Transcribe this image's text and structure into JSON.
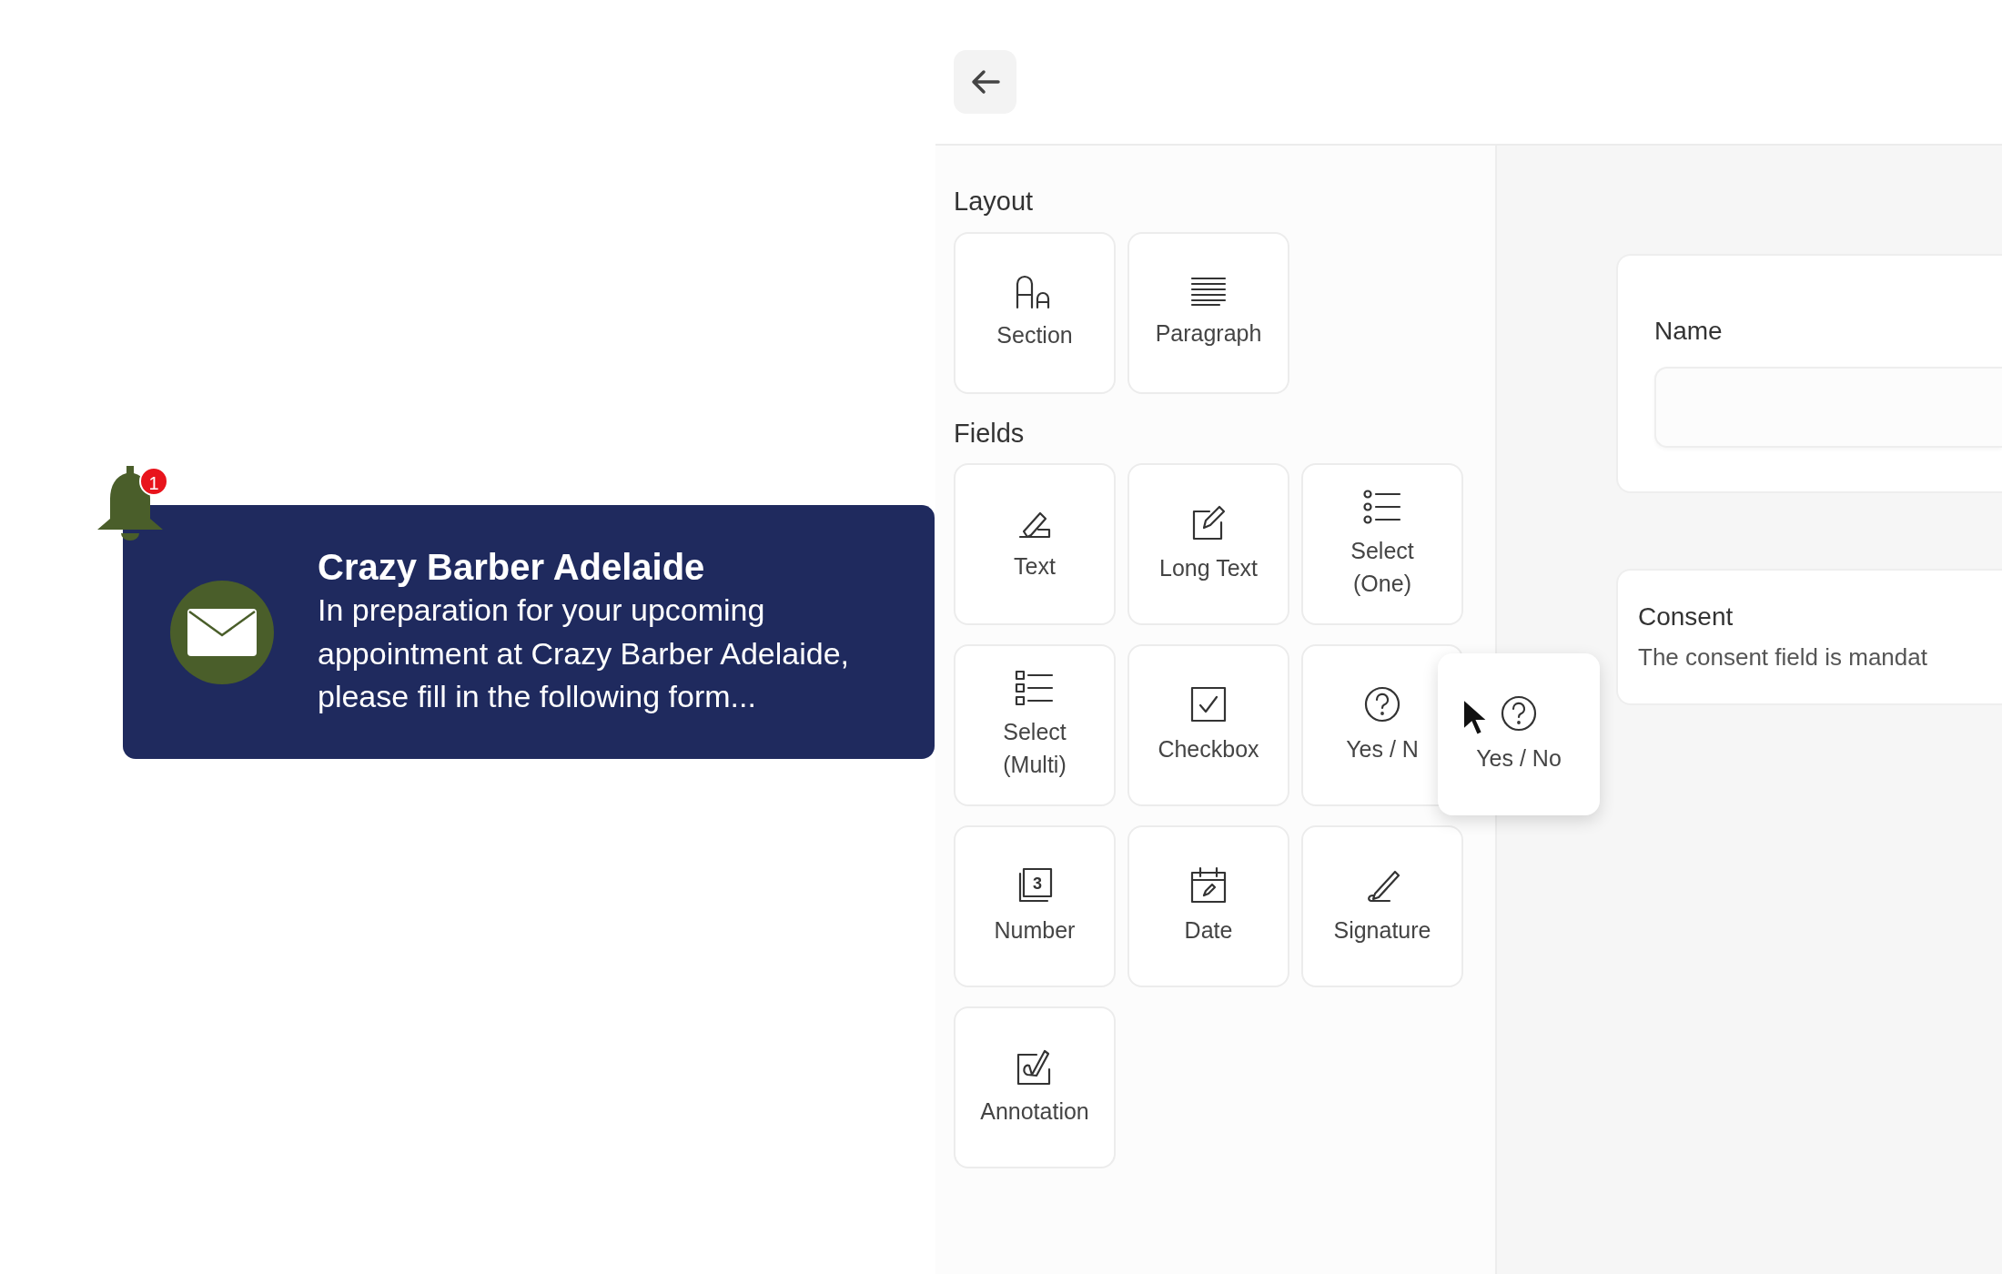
{
  "notification": {
    "badge": "1",
    "title": "Crazy Barber Adelaide",
    "message": "In preparation for your upcoming appointment at Crazy Barber Adelaide, please fill in the following form..."
  },
  "builder": {
    "palette": [
      {
        "heading": "Layout",
        "items": [
          {
            "kind": "section",
            "label": "Section"
          },
          {
            "kind": "paragraph",
            "label": "Paragraph"
          }
        ]
      },
      {
        "heading": "Fields",
        "items": [
          {
            "kind": "text",
            "label": "Text"
          },
          {
            "kind": "longtext",
            "label": "Long Text"
          },
          {
            "kind": "select",
            "label": "Select (One)"
          },
          {
            "kind": "multiselect",
            "label": "Select (Multi)"
          },
          {
            "kind": "checkbox",
            "label": "Checkbox"
          },
          {
            "kind": "yesno",
            "label": "Yes / N"
          },
          {
            "kind": "number",
            "label": "Number",
            "icon_text": "3"
          },
          {
            "kind": "date",
            "label": "Date"
          },
          {
            "kind": "signature",
            "label": "Signature"
          },
          {
            "kind": "annotation",
            "label": "Annotation"
          }
        ]
      }
    ],
    "drag_ghost": {
      "kind": "yesno",
      "label": "Yes / No"
    },
    "form": [
      {
        "kind": "input",
        "label": "Name"
      },
      {
        "kind": "note",
        "label": "Consent",
        "description": "The consent field is mandat"
      }
    ]
  }
}
